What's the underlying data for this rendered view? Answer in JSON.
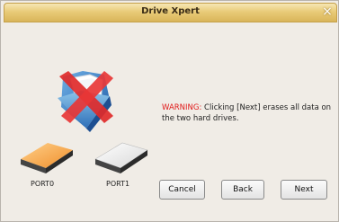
{
  "window": {
    "title": "Drive Xpert",
    "close_glyph": "×"
  },
  "warning": {
    "label": "WARNING:",
    "message": "Clicking [Next] erases all data on the two hard drives."
  },
  "ports": [
    {
      "label": "PORT0",
      "icon": "orange-hard-drive-icon",
      "color": "#f0a030"
    },
    {
      "label": "PORT1",
      "icon": "white-hard-drive-icon",
      "color": "#ffffff"
    }
  ],
  "main_icon": "folder-with-red-x-icon",
  "buttons": {
    "cancel": "Cancel",
    "back": "Back",
    "next": "Next"
  },
  "colors": {
    "warning": "#e01818",
    "titlebar": "#e9cb78"
  }
}
